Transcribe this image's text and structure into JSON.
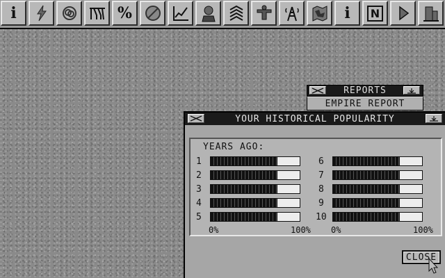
{
  "toolbar": {
    "icons": [
      "info-icon",
      "lightning-icon",
      "rings-icon",
      "factory-icon",
      "percent-icon",
      "no-entry-icon",
      "graph-icon",
      "advisor-icon",
      "chevrons-icon",
      "shield-icon",
      "radio-tower-icon",
      "map-icon",
      "info-icon",
      "newspaper-icon",
      "play-icon",
      "building-icon"
    ],
    "info_glyph": "i",
    "percent_glyph": "%",
    "info2_glyph": "i",
    "news_glyph": "N"
  },
  "reports_menu": {
    "title": "REPORTS",
    "item": "EMPIRE REPORT"
  },
  "window": {
    "title": "YOUR HISTORICAL POPULARITY",
    "years_label": "YEARS AGO:",
    "left_rows": [
      {
        "num": "1",
        "popularity": 0.75
      },
      {
        "num": "2",
        "popularity": 0.75
      },
      {
        "num": "3",
        "popularity": 0.75
      },
      {
        "num": "4",
        "popularity": 0.75
      },
      {
        "num": "5",
        "popularity": 0.75
      }
    ],
    "right_rows": [
      {
        "num": "6",
        "popularity": 0.75
      },
      {
        "num": "7",
        "popularity": 0.75
      },
      {
        "num": "8",
        "popularity": 0.75
      },
      {
        "num": "9",
        "popularity": 0.75
      },
      {
        "num": "10",
        "popularity": 0.75
      }
    ],
    "axis_min": "0%",
    "axis_max": "100%",
    "close_label": "CLOSE"
  }
}
